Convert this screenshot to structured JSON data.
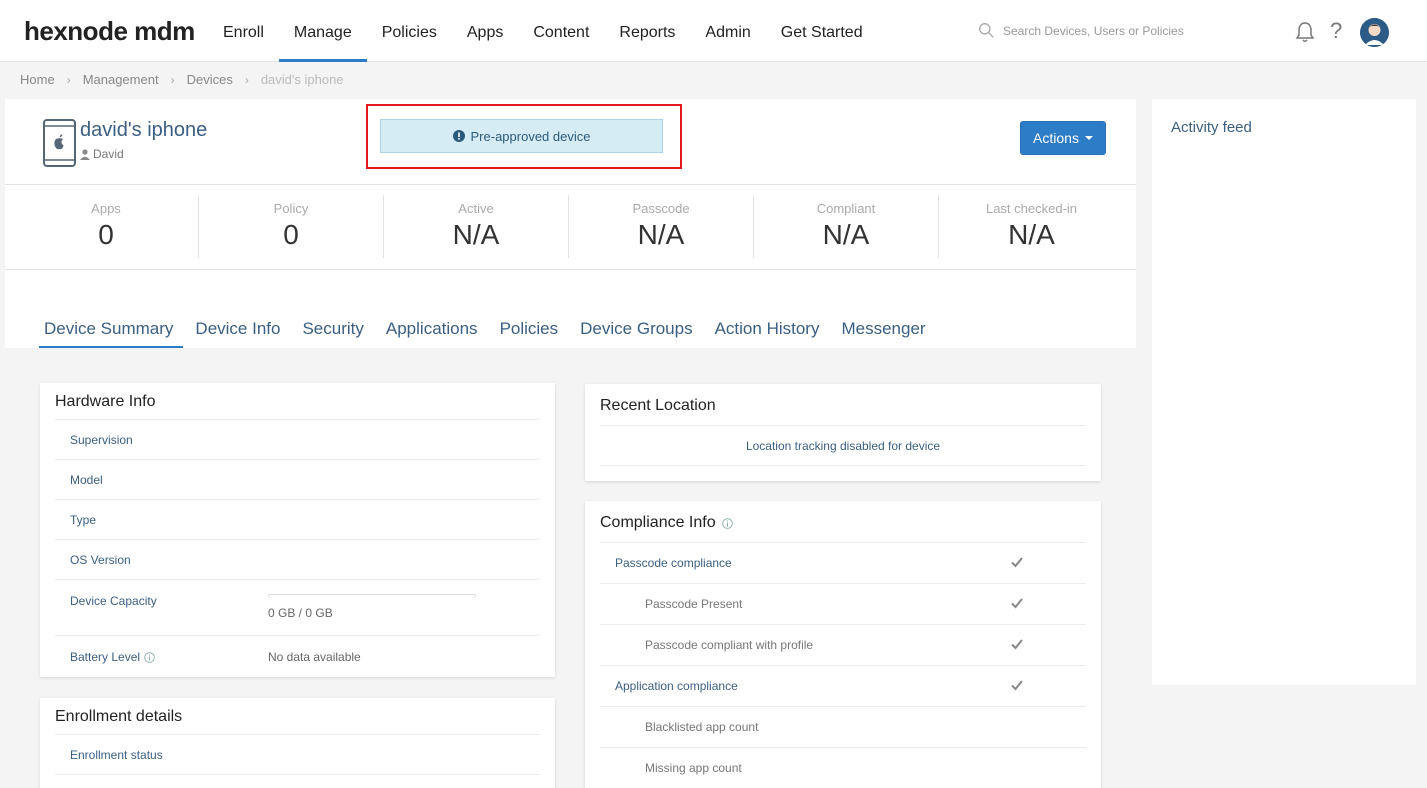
{
  "app": {
    "logo": "hexnode mdm"
  },
  "nav": {
    "items": [
      "Enroll",
      "Manage",
      "Policies",
      "Apps",
      "Content",
      "Reports",
      "Admin",
      "Get Started"
    ],
    "active": "Manage"
  },
  "search": {
    "placeholder": "Search Devices, Users or Policies"
  },
  "topbar": {
    "help_label": "?"
  },
  "breadcrumb": [
    "Home",
    "Management",
    "Devices",
    "david's iphone"
  ],
  "device": {
    "name": "david's iphone",
    "user": "David",
    "status_notice": "Pre-approved device",
    "actions_label": "Actions"
  },
  "stats": [
    {
      "label": "Apps",
      "value": "0"
    },
    {
      "label": "Policy",
      "value": "0"
    },
    {
      "label": "Active",
      "value": "N/A"
    },
    {
      "label": "Passcode",
      "value": "N/A"
    },
    {
      "label": "Compliant",
      "value": "N/A"
    },
    {
      "label": "Last checked-in",
      "value": "N/A"
    }
  ],
  "tabs": [
    "Device Summary",
    "Device Info",
    "Security",
    "Applications",
    "Policies",
    "Device Groups",
    "Action History",
    "Messenger"
  ],
  "active_tab": "Device Summary",
  "hardware": {
    "title": "Hardware Info",
    "rows": [
      {
        "label": "Supervision",
        "value": ""
      },
      {
        "label": "Model",
        "value": ""
      },
      {
        "label": "Type",
        "value": ""
      },
      {
        "label": "OS Version",
        "value": ""
      }
    ],
    "capacity": {
      "label": "Device Capacity",
      "value": "0 GB / 0 GB",
      "used_fraction": 0
    },
    "battery": {
      "label": "Battery Level",
      "value": "No data available"
    }
  },
  "enrollment": {
    "title": "Enrollment details",
    "rows": [
      {
        "label": "Enrollment status",
        "value": ""
      }
    ]
  },
  "location": {
    "title": "Recent Location",
    "message": "Location tracking disabled for device"
  },
  "compliance": {
    "title": "Compliance Info",
    "rows": [
      {
        "label": "Passcode compliance",
        "sub": false,
        "checked": true
      },
      {
        "label": "Passcode Present",
        "sub": true,
        "checked": true
      },
      {
        "label": "Passcode compliant with profile",
        "sub": true,
        "checked": true
      },
      {
        "label": "Application compliance",
        "sub": false,
        "checked": true
      },
      {
        "label": "Blacklisted app count",
        "sub": true,
        "checked": false
      },
      {
        "label": "Missing app count",
        "sub": true,
        "checked": false
      }
    ]
  },
  "feed": {
    "title": "Activity feed"
  },
  "colors": {
    "accent": "#2d7cc7",
    "link": "#3a5f83",
    "highlight_border": "#e1191b",
    "notice_bg": "#d6ecf5"
  }
}
